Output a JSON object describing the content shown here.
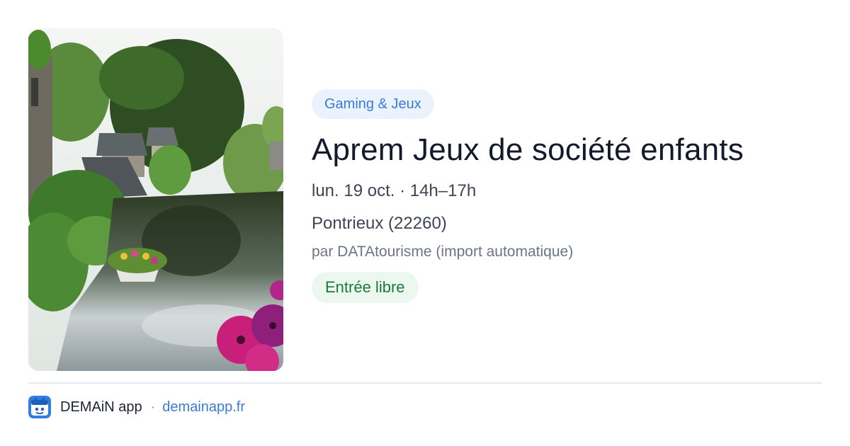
{
  "event": {
    "category": "Gaming & Jeux",
    "title": "Aprem Jeux de société enfants",
    "datetime": "lun. 19 oct. · 14h–17h",
    "location": "Pontrieux (22260)",
    "organizer": "par DATAtourisme (import automatique)",
    "price": "Entrée libre",
    "image_icon": "photo-river-village-flowers"
  },
  "footer": {
    "app_name": "DEMAiN app",
    "separator": "·",
    "domain": "demainapp.fr",
    "logo_icon": "demain-app-logo"
  },
  "colors": {
    "accent": "#3b7bd6",
    "tag_bg": "#eaf2fd",
    "price_text": "#1c7a36",
    "price_bg": "#ecf8ef"
  }
}
